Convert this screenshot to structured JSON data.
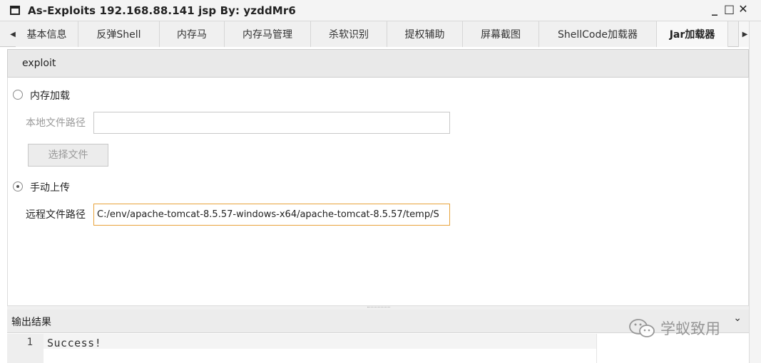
{
  "window": {
    "title": "As-Exploits 192.168.88.141 jsp By: yzddMr6",
    "controls": {
      "minimize": "_",
      "maximize": "□",
      "close": "✕"
    }
  },
  "tabs": [
    {
      "label": "基本信息",
      "active": false
    },
    {
      "label": "反弹Shell",
      "active": false
    },
    {
      "label": "内存马",
      "active": false
    },
    {
      "label": "内存马管理",
      "active": false
    },
    {
      "label": "杀软识别",
      "active": false
    },
    {
      "label": "提权辅助",
      "active": false
    },
    {
      "label": "屏幕截图",
      "active": false
    },
    {
      "label": "ShellCode加载器",
      "active": false
    },
    {
      "label": "Jar加载器",
      "active": true
    }
  ],
  "toolbar": {
    "exploit_label": "exploit"
  },
  "form": {
    "memory_load": {
      "label": "内存加载",
      "checked": false
    },
    "local_path": {
      "label": "本地文件路径",
      "value": ""
    },
    "choose_file_label": "选择文件",
    "manual_upload": {
      "label": "手动上传",
      "checked": true
    },
    "remote_path": {
      "label": "远程文件路径",
      "value": "C:/env/apache-tomcat-8.5.57-windows-x64/apache-tomcat-8.5.57/temp/S"
    }
  },
  "output": {
    "title": "输出结果",
    "lines": [
      {
        "number": "1",
        "text": "Success!"
      }
    ]
  },
  "watermark": {
    "text": "学蚁致用"
  },
  "colors": {
    "focus_border": "#e8a33b",
    "active_tab_bg": "#f8f8f8"
  }
}
